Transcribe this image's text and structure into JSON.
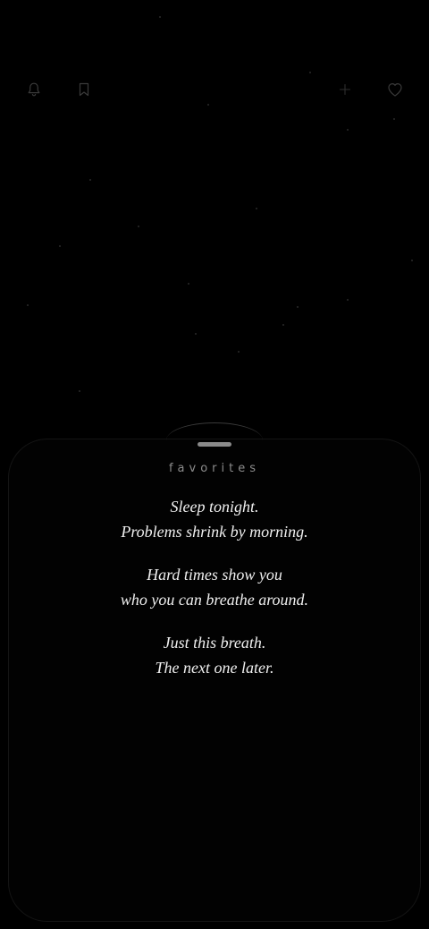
{
  "toolbar": {
    "left_icons": [
      "bell-icon",
      "bookmark-icon"
    ],
    "right_icons": [
      "plus-icon",
      "heart-icon"
    ]
  },
  "sheet": {
    "title": "favorites",
    "quotes": [
      {
        "line1": "Sleep tonight.",
        "line2": "Problems shrink by morning."
      },
      {
        "line1": "Hard times show you",
        "line2": "who you can breathe around."
      },
      {
        "line1": "Just this breath.",
        "line2": "The next one later."
      }
    ]
  },
  "colors": {
    "background": "#000000",
    "icon": "#3a3a3a",
    "quote_text": "#f0f0f0",
    "title_text": "#8c8c8c",
    "handle": "#8a8a8a"
  }
}
